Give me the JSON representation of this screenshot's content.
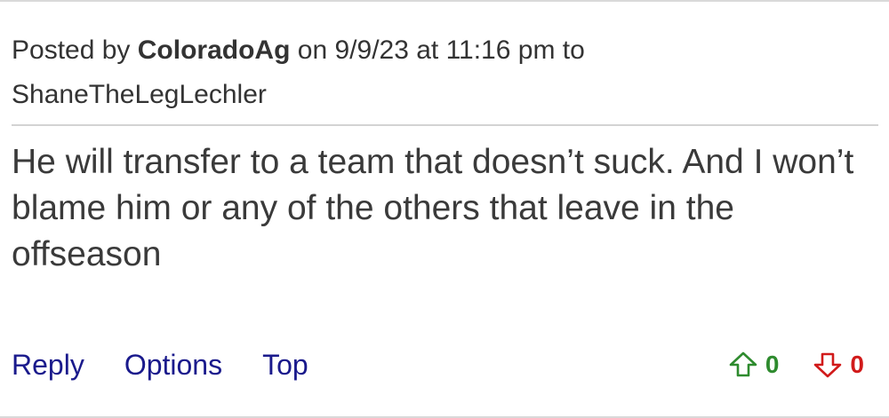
{
  "post": {
    "prefix": "Posted by",
    "author": "ColoradoAg",
    "date_connector": "on",
    "datetime": "9/9/23 at 11:16 pm",
    "to_connector": "to",
    "reply_to": "ShaneTheLegLechler",
    "body": "He will transfer to a team that doesn’t suck. And I won’t blame him or any of the others that leave in the offseason"
  },
  "actions": {
    "reply_label": "Reply",
    "options_label": "Options",
    "top_label": "Top"
  },
  "votes": {
    "up_count": "0",
    "down_count": "0",
    "up_icon": "thumb-up-arrow-icon",
    "down_icon": "thumb-down-arrow-icon",
    "up_color": "#2e8b2e",
    "down_color": "#d11a1a"
  },
  "colors": {
    "link": "#1a1a8c",
    "text": "#3a3a3a",
    "divider": "#d3d3d3"
  }
}
